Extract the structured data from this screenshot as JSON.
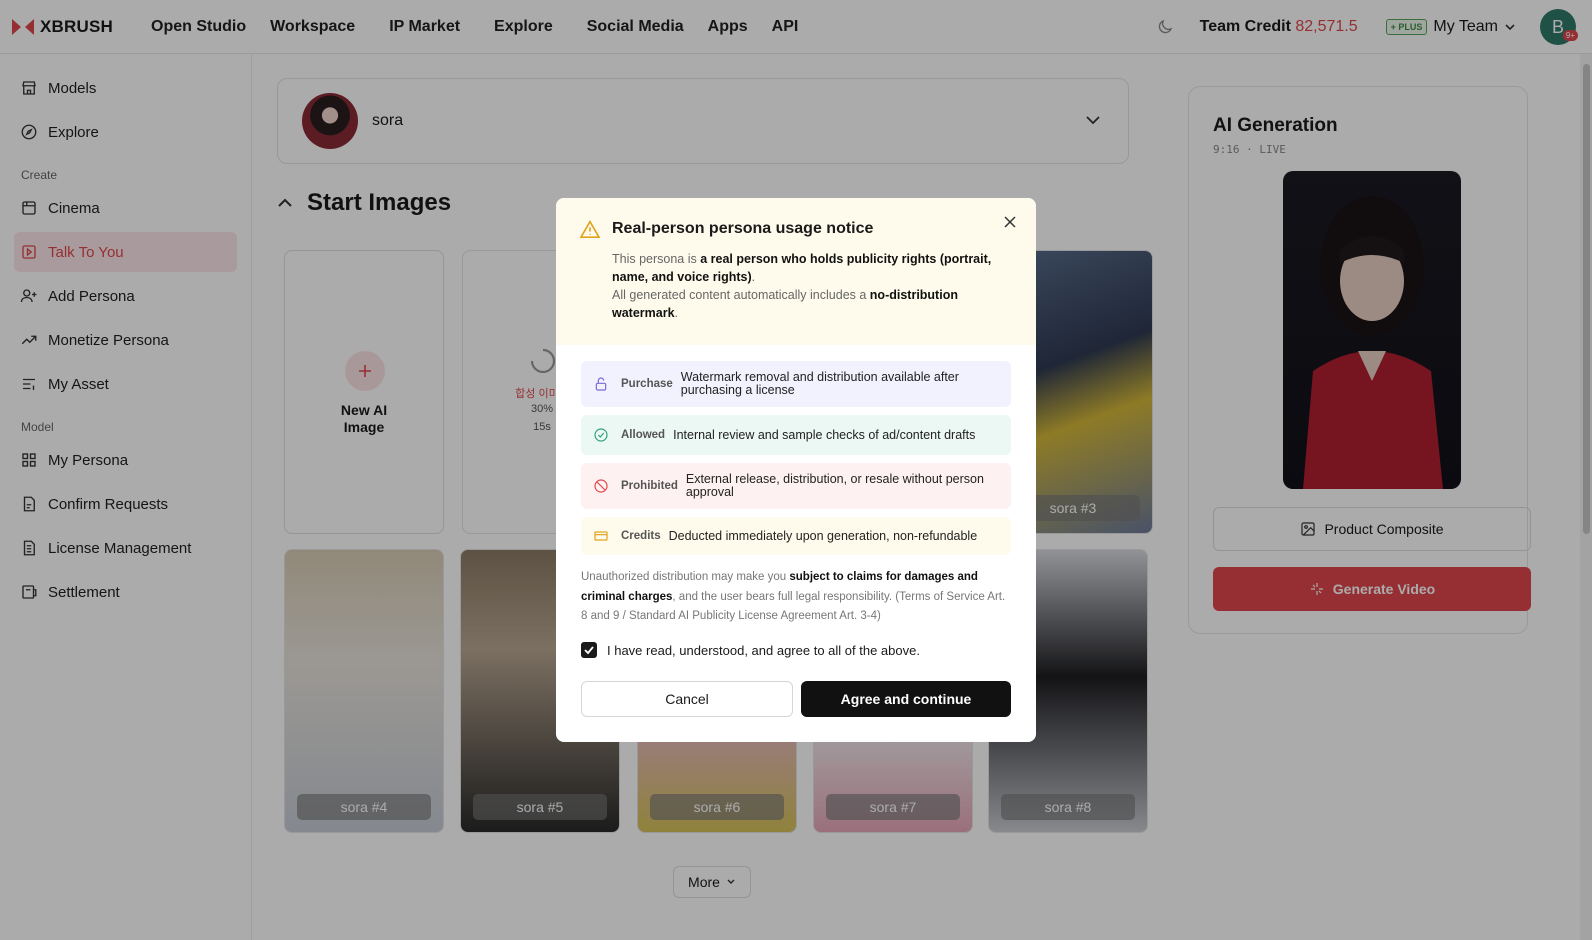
{
  "header": {
    "logo": "XBRUSH",
    "nav": [
      "Open Studio",
      "Workspace",
      "IP Market",
      "Explore",
      "Social Media",
      "Apps",
      "API"
    ],
    "credit_label": "Team Credit",
    "credit_value": "82,571.5",
    "plus_badge": "+ PLUS",
    "team": "My Team",
    "avatar_initial": "B",
    "avatar_badge": "9+"
  },
  "sidebar": {
    "items_top": [
      "Models",
      "Explore"
    ],
    "section_create": "Create",
    "items_create": [
      "Cinema",
      "Talk To You",
      "Add Persona",
      "Monetize Persona",
      "My Asset"
    ],
    "section_model": "Model",
    "items_model": [
      "My Persona",
      "Confirm Requests",
      "License Management",
      "Settlement"
    ],
    "active": "Talk To You"
  },
  "persona": {
    "name": "sora"
  },
  "start_images": {
    "heading": "Start Images",
    "new_label": "New AI Image",
    "loading": {
      "text": "합성 이미지",
      "percent": "30%",
      "time": "15s"
    },
    "cards": [
      "sora #3",
      "sora #4",
      "sora #5",
      "sora #6",
      "sora #7",
      "sora #8"
    ],
    "more": "More"
  },
  "right_panel": {
    "title": "AI Generation",
    "subtitle": "9:16 · LIVE",
    "product_composite": "Product Composite",
    "generate_video": "Generate Video"
  },
  "modal": {
    "title": "Real-person persona usage notice",
    "intro_a": "This persona is ",
    "intro_b": "a real person who holds publicity rights (portrait, name, and voice rights)",
    "intro_c": ".",
    "intro_d": "All generated content automatically includes a ",
    "intro_e": "no-distribution watermark",
    "intro_f": ".",
    "rows": [
      {
        "label": "Purchase",
        "text": "Watermark removal and distribution available after purchasing a license",
        "color": "#f2f1fe"
      },
      {
        "label": "Allowed",
        "text": "Internal review and sample checks of ad/content drafts",
        "color": "#ecf8f3"
      },
      {
        "label": "Prohibited",
        "text": "External release, distribution, or resale without person approval",
        "color": "#fef1f1"
      },
      {
        "label": "Credits",
        "text": "Deducted immediately upon generation, non-refundable",
        "color": "#fffbec"
      }
    ],
    "disclaimer_a": "Unauthorized distribution may make you ",
    "disclaimer_b": "subject to claims for damages and criminal charges",
    "disclaimer_c": ", and the user bears full legal responsibility. (Terms of Service Art. 8 and 9 / Standard AI Publicity License Agreement Art. 3-4)",
    "checkbox_label": "I have read, understood, and agree to all of the above.",
    "checked": true,
    "cancel": "Cancel",
    "agree": "Agree and continue"
  }
}
